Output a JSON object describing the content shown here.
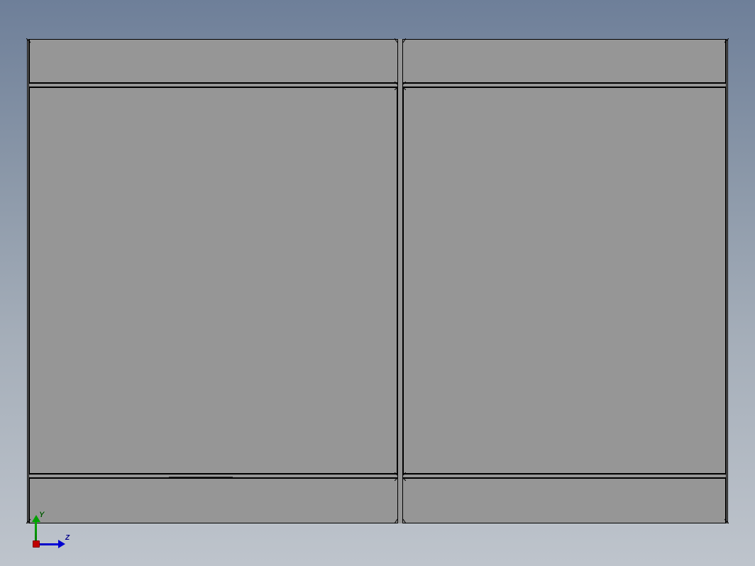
{
  "viewport": {
    "background_gradient_top": "#6e7f99",
    "background_gradient_bottom": "#bec4cc",
    "model_color": "#969696",
    "edge_color": "#000000"
  },
  "axes": {
    "y_label": "Y",
    "z_label": "Z",
    "y_color": "#00a000",
    "z_color": "#0000d0",
    "origin_color": "#c00000"
  }
}
